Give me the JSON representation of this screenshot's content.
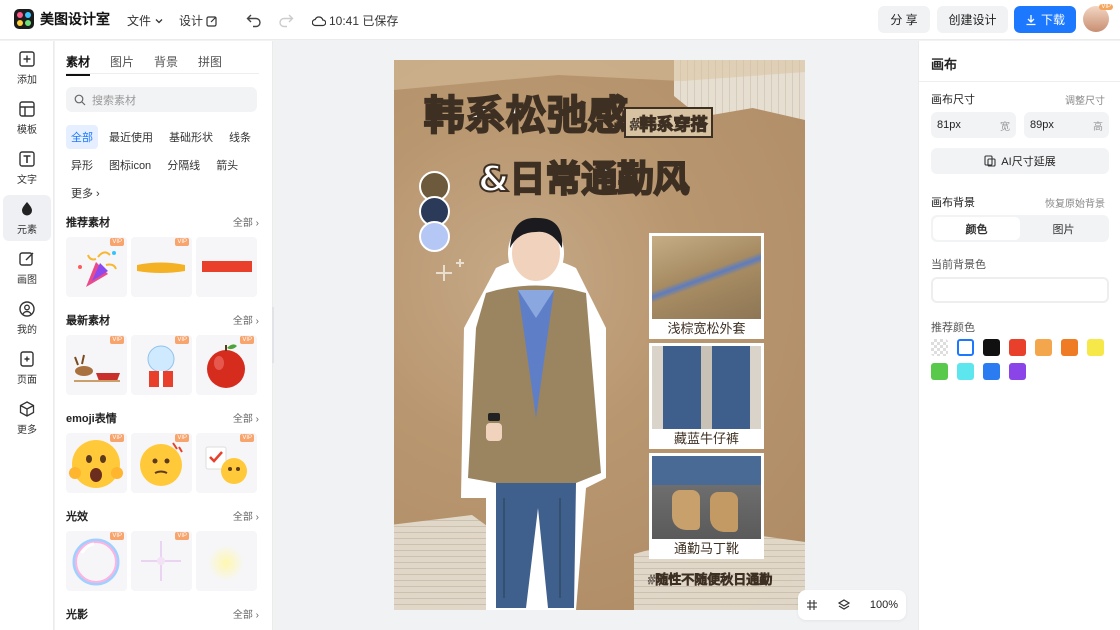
{
  "app": {
    "name": "美图设计室",
    "save_status": "10:41 已保存"
  },
  "topbar": {
    "menu_file": "文件",
    "menu_design": "设计",
    "share": "分 享",
    "create": "创建设计",
    "download": "下载",
    "vip_badge": "VIP"
  },
  "rail": [
    {
      "label": "添加",
      "icon": "plus-square-icon"
    },
    {
      "label": "模板",
      "icon": "template-icon"
    },
    {
      "label": "文字",
      "icon": "text-icon"
    },
    {
      "label": "元素",
      "icon": "element-icon"
    },
    {
      "label": "画图",
      "icon": "draw-icon"
    },
    {
      "label": "我的",
      "icon": "user-icon"
    },
    {
      "label": "页面",
      "icon": "page-add-icon"
    },
    {
      "label": "更多",
      "icon": "box-icon"
    }
  ],
  "panel": {
    "tabs": [
      "素材",
      "图片",
      "背景",
      "拼图"
    ],
    "search_placeholder": "搜索素材",
    "chips": [
      "全部",
      "最近使用",
      "基础形状",
      "线条",
      "异形",
      "图标icon",
      "分隔线",
      "箭头",
      "更多"
    ],
    "all_label": "全部",
    "vip": "VIP",
    "sections": [
      {
        "title": "推荐素材"
      },
      {
        "title": "最新素材"
      },
      {
        "title": "emoji表情"
      },
      {
        "title": "光效"
      },
      {
        "title": "光影"
      }
    ]
  },
  "poster": {
    "title1": "韩系松弛感",
    "tag": "#韩系穿搭",
    "title2": "&日常通勤风",
    "palette": [
      "#6d5a3c",
      "#2a3a58",
      "#b5c7f5"
    ],
    "items": [
      {
        "caption": "浅棕宽松外套"
      },
      {
        "caption": "藏蓝牛仔裤"
      },
      {
        "caption": "通勤马丁靴"
      }
    ],
    "footer": "#随性不随便秋日通勤"
  },
  "zoom": {
    "level": "100%"
  },
  "right": {
    "title": "画布",
    "size_label": "画布尺寸",
    "adjust_size": "调整尺寸",
    "width_value": "81px",
    "width_unit": "宽",
    "height_value": "89px",
    "height_unit": "高",
    "ai_extend": "AI尺寸延展",
    "bg_label": "画布背景",
    "restore_bg": "恢复原始背景",
    "seg_color": "颜色",
    "seg_image": "图片",
    "current_bg": "当前背景色",
    "recommended": "推荐颜色",
    "swatches": [
      "transparent",
      "#ffffff",
      "#111111",
      "#e8402a",
      "#f3a64b",
      "#ef7b24",
      "#f7e84a",
      "#58c94a",
      "#5ee6ef",
      "#2a7cf0",
      "#8a44e8"
    ]
  }
}
